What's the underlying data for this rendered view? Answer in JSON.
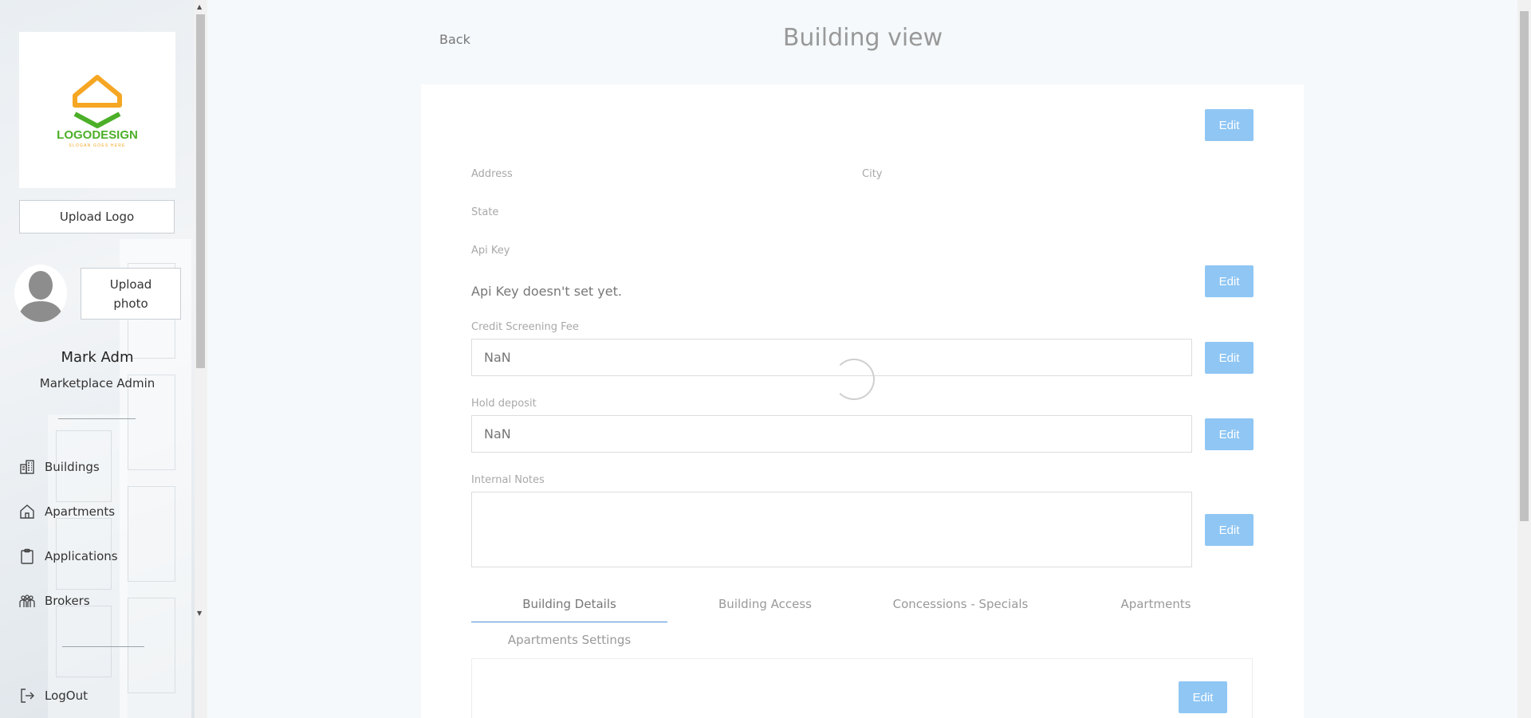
{
  "sidebar": {
    "logo": {
      "text": "LOGODESIGN",
      "tagline": "SLOGAN GOES HERE"
    },
    "upload_logo_label": "Upload Logo",
    "upload_photo_label": "Upload photo",
    "user": {
      "name": "Mark Adm",
      "role": "Marketplace Admin"
    },
    "nav": [
      {
        "label": "Buildings",
        "icon": "buildings-icon"
      },
      {
        "label": "Apartments",
        "icon": "home-icon"
      },
      {
        "label": "Applications",
        "icon": "clipboard-icon"
      },
      {
        "label": "Brokers",
        "icon": "people-icon"
      }
    ],
    "logout_label": "LogOut"
  },
  "header": {
    "back_label": "Back",
    "title": "Building view"
  },
  "details": {
    "address_label": "Address",
    "city_label": "City",
    "state_label": "State",
    "api_key_label": "Api Key",
    "api_key_value": "Api Key doesn't set yet.",
    "credit_fee_label": "Credit Screening Fee",
    "credit_fee_value": "NaN",
    "hold_deposit_label": "Hold deposit",
    "hold_deposit_value": "NaN",
    "internal_notes_label": "Internal Notes",
    "internal_notes_value": "",
    "edit_label": "Edit"
  },
  "tabs": [
    {
      "label": "Building Details",
      "active": true
    },
    {
      "label": "Building Access",
      "active": false
    },
    {
      "label": "Concessions - Specials",
      "active": false
    },
    {
      "label": "Apartments",
      "active": false
    },
    {
      "label": "Apartments Settings",
      "active": false
    }
  ],
  "colors": {
    "button": "#8fc6f4",
    "tab_active_underline": "#4a8fd6",
    "logo_orange": "#f5a623",
    "logo_green": "#4caf28"
  }
}
